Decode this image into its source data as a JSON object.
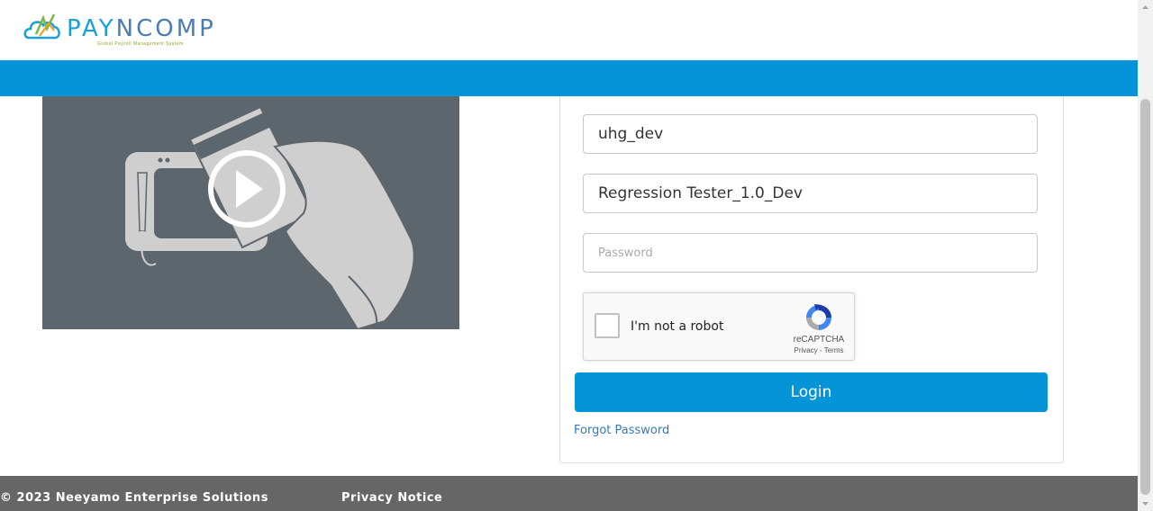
{
  "header": {
    "logo_text_a": "PAY",
    "logo_text_b": "NCOMP",
    "logo_tagline": "Global Payroll Management System"
  },
  "login_form": {
    "username_value": "uhg_dev",
    "role_value": "Regression Tester_1.0_Dev",
    "password_placeholder": "Password",
    "login_label": "Login",
    "forgot_password_label": "Forgot Password"
  },
  "captcha": {
    "label": "I'm not a robot",
    "brand": "reCAPTCHA",
    "links": "Privacy - Terms"
  },
  "footer": {
    "copyright": "© 2023 Neeyamo Enterprise Solutions",
    "privacy_label": "Privacy Notice"
  },
  "colors": {
    "primary": "#0494d7",
    "footer": "#666666",
    "video_bg": "#5e666d",
    "link": "#337ab7"
  },
  "icons": [
    "paycomp-logo",
    "play-icon",
    "recaptcha-logo-icon"
  ]
}
